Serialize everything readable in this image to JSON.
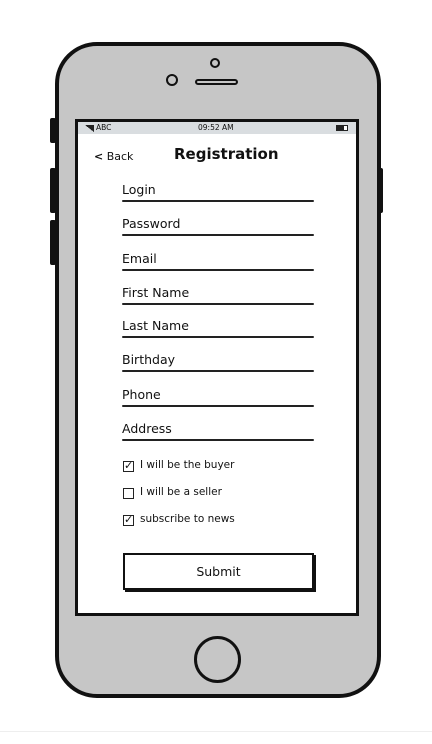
{
  "status_bar": {
    "carrier": "ABC",
    "time": "09:52 AM",
    "battery_icon": "battery-icon",
    "signal_icon": "signal-icon"
  },
  "header": {
    "back_label": "Back",
    "title": "Registration"
  },
  "fields": [
    {
      "label": "Login"
    },
    {
      "label": "Password"
    },
    {
      "label": "Email"
    },
    {
      "label": "First Name"
    },
    {
      "label": "Last Name"
    },
    {
      "label": "Birthday"
    },
    {
      "label": "Phone"
    },
    {
      "label": "Address"
    }
  ],
  "checkboxes": [
    {
      "label": "I will be the buyer",
      "checked": true
    },
    {
      "label": "I will be a seller",
      "checked": false
    },
    {
      "label": "subscribe to news",
      "checked": true
    }
  ],
  "submit_label": "Submit"
}
